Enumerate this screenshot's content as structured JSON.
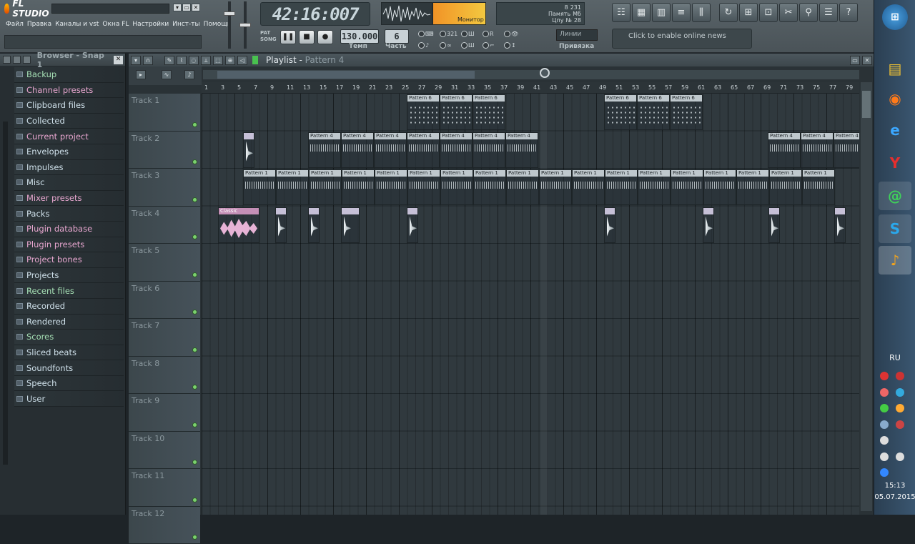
{
  "app": {
    "title": "FL STUDIO"
  },
  "menu": [
    "Файл",
    "Правка",
    "Каналы и vst",
    "Окна FL",
    "Настройки",
    "Инст-ты",
    "Помощь"
  ],
  "transport": {
    "time": "42:16:007",
    "tempo_value": "130.000",
    "tempo_label": "Темп",
    "part_value": "6",
    "part_label": "Часть",
    "monitor_label": "Монитор",
    "pat_label": "PAT",
    "song_label": "SONG"
  },
  "cpu": {
    "memory_label": "Память",
    "memory_value": "231",
    "memory_unit": "Мб",
    "cpu_label": "Цпу",
    "cpu_value": "8",
    "num_label": "№",
    "num_value": "28"
  },
  "snap": {
    "value": "Линии",
    "label": "Привязка"
  },
  "news": {
    "text": "Click to enable online news"
  },
  "browser": {
    "title": "Browser - Snap 1",
    "items": [
      {
        "label": "Backup",
        "color": "green"
      },
      {
        "label": "Channel presets",
        "color": "pink"
      },
      {
        "label": "Clipboard files",
        "color": "blue"
      },
      {
        "label": "Collected",
        "color": "blue"
      },
      {
        "label": "Current project",
        "color": "pink"
      },
      {
        "label": "Envelopes",
        "color": "blue"
      },
      {
        "label": "Impulses",
        "color": "blue"
      },
      {
        "label": "Misc",
        "color": "blue"
      },
      {
        "label": "Mixer presets",
        "color": "pink"
      },
      {
        "label": "Packs",
        "color": "blue"
      },
      {
        "label": "Plugin database",
        "color": "pink"
      },
      {
        "label": "Plugin presets",
        "color": "pink"
      },
      {
        "label": "Project bones",
        "color": "pink"
      },
      {
        "label": "Projects",
        "color": "blue"
      },
      {
        "label": "Recent files",
        "color": "green"
      },
      {
        "label": "Recorded",
        "color": "blue"
      },
      {
        "label": "Rendered",
        "color": "blue"
      },
      {
        "label": "Scores",
        "color": "green"
      },
      {
        "label": "Sliced beats",
        "color": "blue"
      },
      {
        "label": "Soundfonts",
        "color": "blue"
      },
      {
        "label": "Speech",
        "color": "blue"
      },
      {
        "label": "User",
        "color": "blue"
      }
    ]
  },
  "playlist": {
    "title": "Playlist",
    "pattern": "Pattern 4",
    "ruler": [
      "1",
      "3",
      "5",
      "7",
      "9",
      "11",
      "13",
      "15",
      "17",
      "19",
      "21",
      "23",
      "25",
      "27",
      "29",
      "31",
      "33",
      "35",
      "37",
      "39",
      "41",
      "43",
      "45",
      "47",
      "49",
      "51",
      "53",
      "55",
      "57",
      "59",
      "61",
      "63",
      "65",
      "67",
      "69",
      "71",
      "73",
      "75",
      "77",
      "79"
    ],
    "tracks": [
      "Track 1",
      "Track 2",
      "Track 3",
      "Track 4",
      "Track 5",
      "Track 6",
      "Track 7",
      "Track 8",
      "Track 9",
      "Track 10",
      "Track 11",
      "Track 12"
    ],
    "clip_names": {
      "p6": "Pattern 6",
      "p4": "Pattern 4",
      "p1": "Pattern 1",
      "classic": "Classic"
    }
  },
  "taskbar": {
    "lang": "RU",
    "time": "15:13",
    "date": "05.07.2015"
  }
}
